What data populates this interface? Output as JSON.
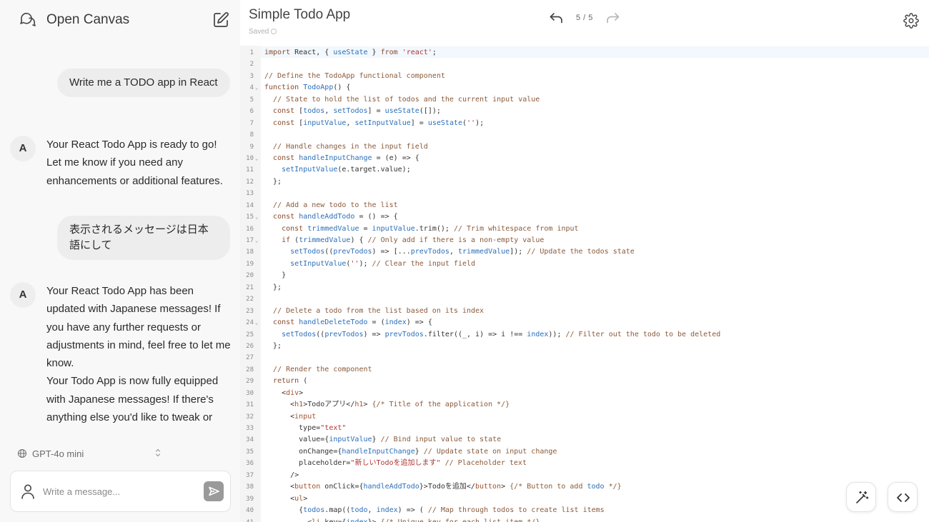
{
  "app": {
    "title": "Open Canvas"
  },
  "chat": {
    "messages": [
      {
        "role": "user",
        "text": "Write me a TODO app in React"
      },
      {
        "role": "assistant",
        "avatar": "A",
        "text": "Your React Todo App is ready to go! Let me know if you need any enhancements or additional features."
      },
      {
        "role": "user",
        "text": "表示されるメッセージは日本語にして"
      },
      {
        "role": "assistant",
        "avatar": "A",
        "text": "Your React Todo App has been updated with Japanese messages! If you have any further requests or adjustments in mind, feel free to let me know.\nYour Todo App is now fully equipped with Japanese messages! If there's anything else you'd like to tweak or"
      }
    ]
  },
  "model_selector": {
    "selected": "GPT-4o mini"
  },
  "composer": {
    "placeholder": "Write a message..."
  },
  "canvas": {
    "title": "Simple Todo App",
    "status": "Saved",
    "version": "5 / 5"
  },
  "code": {
    "language": "javascript",
    "lines": [
      "import React, { useState } from 'react';",
      "",
      "// Define the TodoApp functional component",
      "function TodoApp() {",
      "  // State to hold the list of todos and the current input value",
      "  const [todos, setTodos] = useState([]);",
      "  const [inputValue, setInputValue] = useState('');",
      "",
      "  // Handle changes in the input field",
      "  const handleInputChange = (e) => {",
      "    setInputValue(e.target.value);",
      "  };",
      "",
      "  // Add a new todo to the list",
      "  const handleAddTodo = () => {",
      "    const trimmedValue = inputValue.trim(); // Trim whitespace from input",
      "    if (trimmedValue) { // Only add if there is a non-empty value",
      "      setTodos((prevTodos) => [...prevTodos, trimmedValue]); // Update the todos state",
      "      setInputValue(''); // Clear the input field",
      "    }",
      "  };",
      "",
      "  // Delete a todo from the list based on its index",
      "  const handleDeleteTodo = (index) => {",
      "    setTodos((prevTodos) => prevTodos.filter((_, i) => i !== index)); // Filter out the todo to be deleted",
      "  };",
      "",
      "  // Render the component",
      "  return (",
      "    <div>",
      "      <h1>Todoアプリ</h1> {/* Title of the application */}",
      "      <input",
      "        type=\"text\"",
      "        value={inputValue} // Bind input value to state",
      "        onChange={handleInputChange} // Update state on input change",
      "        placeholder=\"新しいTodoを追加します\" // Placeholder text",
      "      />",
      "      <button onClick={handleAddTodo}>Todoを追加</button> {/* Button to add todo */}",
      "      <ul>",
      "        {todos.map((todo, index) => ( // Map through todos to create list items",
      "          <li key={index}> {/* Unique key for each list item */}"
    ],
    "foldable_lines": [
      4,
      10,
      15,
      17,
      24
    ]
  }
}
